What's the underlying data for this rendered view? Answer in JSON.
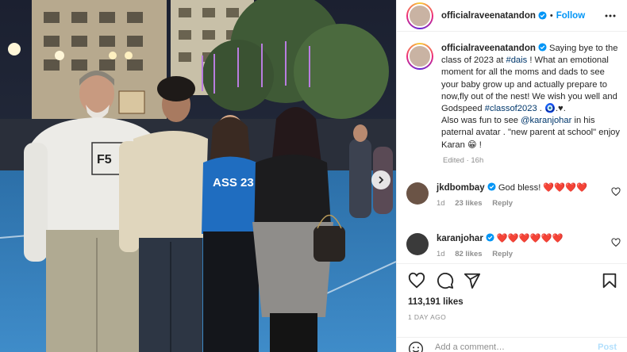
{
  "photo": {
    "alt": "Photo of four people at a school event",
    "shirt_text": "F5",
    "jersey_text": "ASS 23"
  },
  "header": {
    "username": "officialraveenatandon",
    "separator": "•",
    "follow_label": "Follow",
    "more_icon": "more-dots-icon"
  },
  "caption": {
    "username": "officialraveenatandon",
    "text_1": " Saying bye to the class of 2023 at ",
    "tag_1": "#dais",
    "text_2": " ! What an emotional moment for all the moms and dads to see your baby grow up and actually prepare to now,fly out of the nest! We wish you well and Godspeed ",
    "tag_2": "#classof2023",
    "text_3": " . 🧿.♥.",
    "text_4": "Also was fun to see ",
    "tag_3": "@karanjohar",
    "text_5": " in his paternal avatar . \"new parent at school\" enjoy Karan 😁 !",
    "edited": "Edited · 16h"
  },
  "comments": [
    {
      "username": "jkdbombay",
      "text": " God bless! ❤️❤️❤️❤️",
      "age": "1d",
      "likes": "23 likes",
      "reply": "Reply"
    },
    {
      "username": "karanjohar",
      "text": " ❤️❤️❤️❤️❤️❤️",
      "age": "1d",
      "likes": "82 likes",
      "reply": "Reply"
    }
  ],
  "actions": {
    "likes": "113,191 likes",
    "time_ago": "1 DAY AGO",
    "comment_placeholder": "Add a comment…",
    "post_label": "Post"
  },
  "colors": {
    "accent": "#0095f6",
    "link": "#00376b",
    "heart": "#ed4956",
    "muted": "#8e8e8e"
  }
}
